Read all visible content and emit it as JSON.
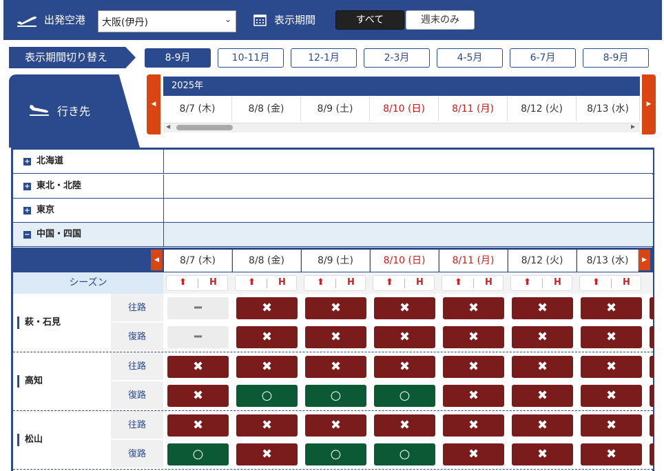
{
  "header": {
    "departure_label": "出発空港",
    "departure_value": "大阪(伊丹)",
    "period_label": "表示期間",
    "period_all": "すべて",
    "period_weekend": "週末のみ"
  },
  "period_switch": {
    "label": "表示期間切り替え",
    "tabs": [
      "8-9月",
      "10-11月",
      "12-1月",
      "2-3月",
      "4-5月",
      "6-7月",
      "8-9月"
    ],
    "active_index": 0
  },
  "destination_label": "行き先",
  "year_label": "2025年",
  "dates": [
    {
      "label": "8/7 (木)",
      "holiday": false
    },
    {
      "label": "8/8 (金)",
      "holiday": false
    },
    {
      "label": "8/9 (土)",
      "holiday": false
    },
    {
      "label": "8/10 (日)",
      "holiday": true
    },
    {
      "label": "8/11 (月)",
      "holiday": true
    },
    {
      "label": "8/12 (火)",
      "holiday": false
    },
    {
      "label": "8/13 (水)",
      "holiday": false
    }
  ],
  "regions": [
    {
      "name": "北海道",
      "expanded": false
    },
    {
      "name": "東北・北陸",
      "expanded": false
    },
    {
      "name": "東京",
      "expanded": false
    },
    {
      "name": "中国・四国",
      "expanded": true
    }
  ],
  "season_label": "シーズン",
  "season_marks": {
    "up": "⬆",
    "h": "H"
  },
  "direction_labels": {
    "outbound": "往路",
    "return": "復路"
  },
  "routes": [
    {
      "name": "萩・石見",
      "outbound": [
        "none",
        "x",
        "x",
        "x",
        "x",
        "x",
        "x"
      ],
      "return": [
        "none",
        "x",
        "x",
        "x",
        "x",
        "x",
        "x"
      ]
    },
    {
      "name": "高知",
      "outbound": [
        "x",
        "x",
        "x",
        "x",
        "x",
        "x",
        "x"
      ],
      "return": [
        "x",
        "o",
        "o",
        "o",
        "x",
        "x",
        "x"
      ]
    },
    {
      "name": "松山",
      "outbound": [
        "x",
        "x",
        "x",
        "x",
        "x",
        "x",
        "x"
      ],
      "return": [
        "o",
        "x",
        "o",
        "o",
        "x",
        "x",
        "x"
      ]
    }
  ],
  "mark_glyphs": {
    "x": "✖",
    "o": "○",
    "none": "━"
  },
  "colors": {
    "brand": "#2b4a8e",
    "accent": "#d94612",
    "unavailable": "#7a1c1c",
    "available": "#0c5a35",
    "holiday": "#cc1a1a"
  }
}
